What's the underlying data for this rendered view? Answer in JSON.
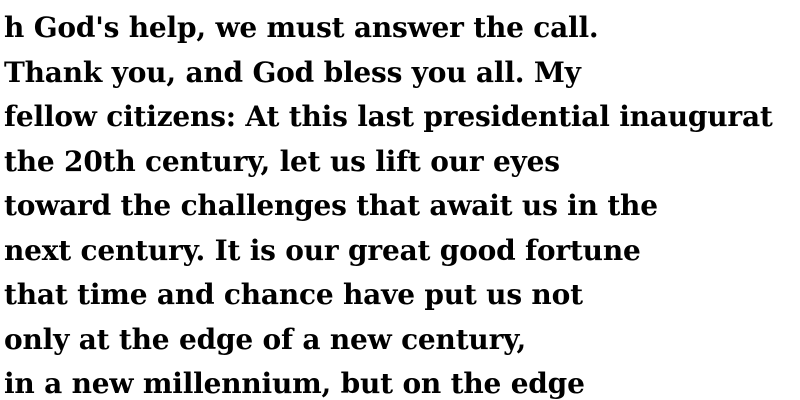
{
  "lines": [
    "h God's help, we must answer the call.",
    "Thank you, and God bless you all. My",
    "fellow citizens: At this last presidential inaugurat",
    "the 20th century, let us lift our eyes",
    "toward the challenges that await us in the",
    "next century. It is our great good fortune",
    "that time and chance have put us not",
    "only at the edge of a new century,",
    "in a new millennium, but on the edge"
  ]
}
